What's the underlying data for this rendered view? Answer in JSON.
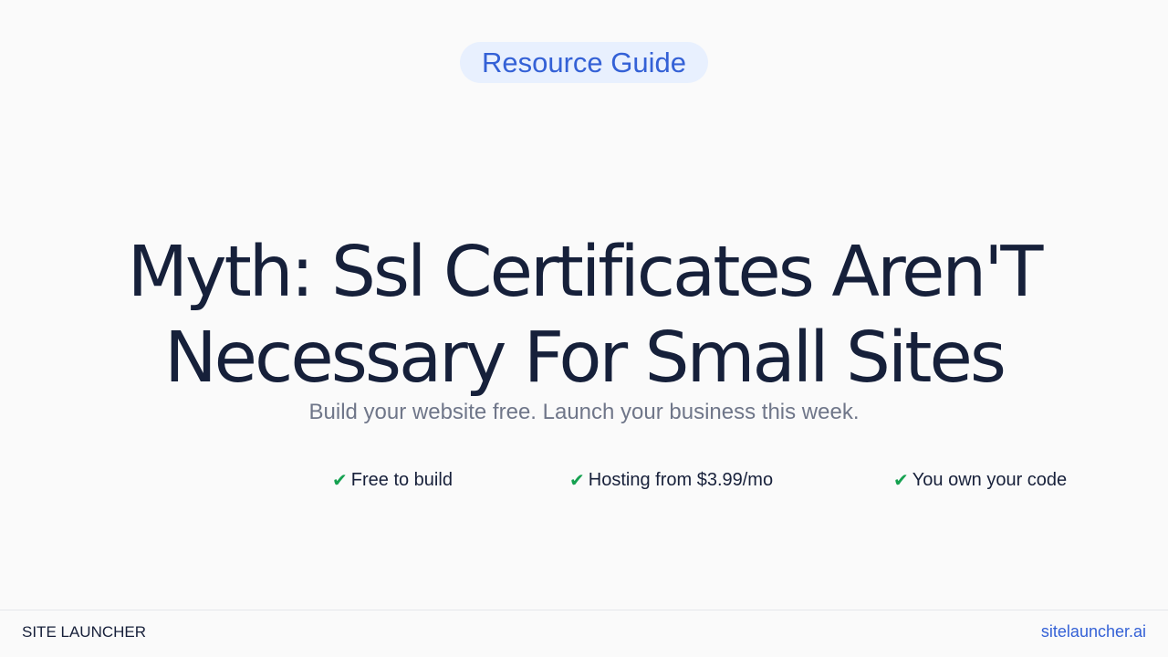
{
  "badge": {
    "label": "Resource Guide"
  },
  "headline": {
    "line1": "Myth: Ssl Certificates Aren'T",
    "line2": "Necessary For Small Sites"
  },
  "subheadline": "Build your website free. Launch your business this week.",
  "features": [
    {
      "icon": "checkmark-icon",
      "label": "Free to build"
    },
    {
      "icon": "checkmark-icon",
      "label": "Hosting from $3.99/mo"
    },
    {
      "icon": "checkmark-icon",
      "label": "You own your code"
    }
  ],
  "footer": {
    "brand": "SITE LAUNCHER",
    "link": "sitelauncher.ai"
  },
  "colors": {
    "background": "#fafafa",
    "accent": "#3461d6",
    "badge_background": "#e8f0fe",
    "headline": "#16203a",
    "muted_text": "#6f7689",
    "check": "#15a150"
  }
}
